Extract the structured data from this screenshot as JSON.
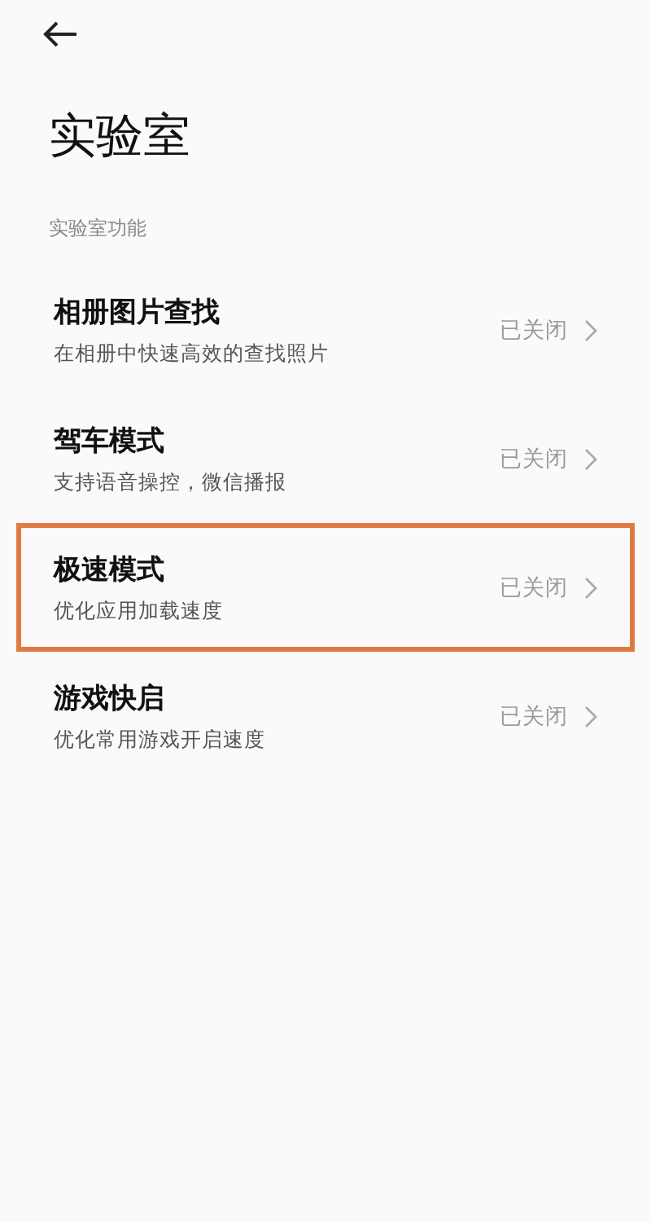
{
  "title": "实验室",
  "section_label": "实验室功能",
  "items": [
    {
      "title": "相册图片查找",
      "subtitle": "在相册中快速高效的查找照片",
      "status": "已关闭",
      "highlighted": false
    },
    {
      "title": "驾车模式",
      "subtitle": "支持语音操控，微信播报",
      "status": "已关闭",
      "highlighted": false
    },
    {
      "title": "极速模式",
      "subtitle": "优化应用加载速度",
      "status": "已关闭",
      "highlighted": true
    },
    {
      "title": "游戏快启",
      "subtitle": "优化常用游戏开启速度",
      "status": "已关闭",
      "highlighted": false
    }
  ]
}
